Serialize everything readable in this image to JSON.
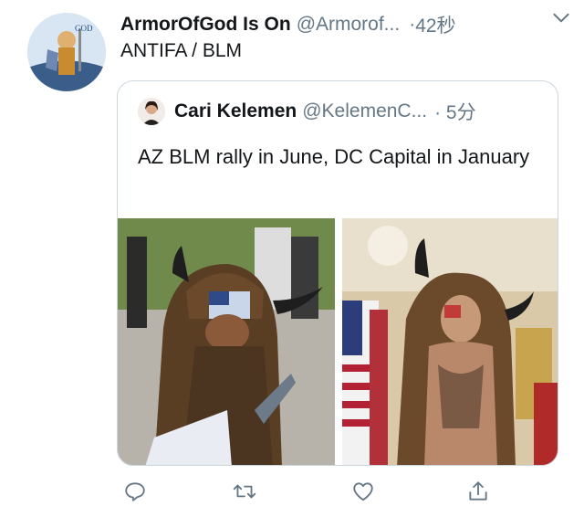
{
  "tweet": {
    "display_name": "ArmorOfGod Is On",
    "handle": "@Armorof...",
    "separator": "·",
    "timestamp": "42秒",
    "text": "ANTIFA / BLM",
    "avatar_icon": "armor-of-god-avatar-icon"
  },
  "quoted": {
    "display_name": "Cari Kelemen",
    "handle": "@KelemenC...",
    "timestamp": "· 5分",
    "text": "AZ BLM rally in June, DC Capital in January"
  },
  "actions": {
    "reply_icon": "reply-icon",
    "retweet_icon": "retweet-icon",
    "like_icon": "heart-icon",
    "share_icon": "share-icon"
  },
  "colors": {
    "text_primary": "#14171a",
    "text_secondary": "#657786",
    "border": "#ccd6dd",
    "icon": "#657786"
  }
}
